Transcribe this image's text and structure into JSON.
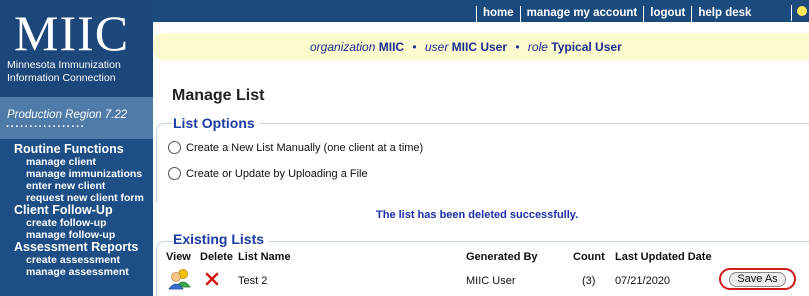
{
  "sidebar": {
    "logo_text": "MIIC",
    "logo_sub_1": "Minnesota Immunization",
    "logo_sub_2": "Information Connection",
    "region": "Production Region 7.22",
    "dots": "·················",
    "sections": [
      {
        "heading": "Routine Functions",
        "items": [
          "manage client",
          "manage immunizations",
          "enter new client",
          "request new client form"
        ]
      },
      {
        "heading": "Client Follow-Up",
        "items": [
          "create follow-up",
          "manage follow-up"
        ]
      },
      {
        "heading": "Assessment Reports",
        "items": [
          "create assessment",
          "manage assessment"
        ]
      }
    ]
  },
  "topnav": {
    "links": [
      "home",
      "manage my account",
      "logout",
      "help desk"
    ],
    "tip_icon": "lightbulb-icon"
  },
  "info": {
    "org_label": "organization",
    "org_value": "MIIC",
    "user_label": "user",
    "user_value": "MIIC User",
    "role_label": "role",
    "role_value": "Typical User",
    "sep": "•"
  },
  "page": {
    "title": "Manage List",
    "list_options_title": "List Options",
    "option_manual": "Create a New List Manually (one client at a time)",
    "option_upload": "Create or Update by Uploading a File",
    "message": "The list has been deleted successfully.",
    "existing_title": "Existing Lists"
  },
  "table": {
    "headers": {
      "view": "View",
      "delete": "Delete",
      "list_name": "List Name",
      "generated_by": "Generated By",
      "count": "Count",
      "last_updated": "Last Updated Date"
    },
    "rows": [
      {
        "list_name": "Test 2",
        "generated_by": "MIIC User",
        "count": "(3)",
        "last_updated": "07/21/2020",
        "action": "Save As",
        "view_icon": "people-icon",
        "delete_icon": "delete-x-icon"
      }
    ]
  },
  "colors": {
    "sidebar": "#1d4f86",
    "accent_blue": "#1b3ba0",
    "highlight_red": "#d11a1a",
    "strip_yellow": "#fbfbcf"
  }
}
